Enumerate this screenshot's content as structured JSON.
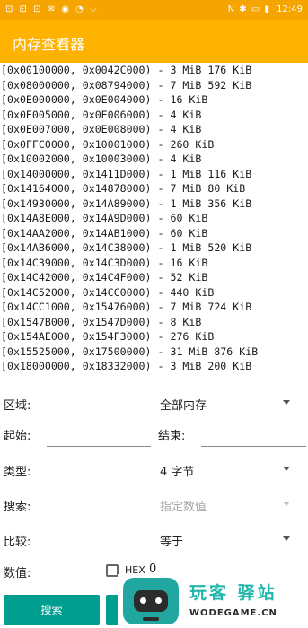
{
  "status_bar": {
    "left_icons": "⊡ ⊡ ⊡ ✉ ◉ ◔ ⌵",
    "right_icons": "N ✱ ▭ ▮",
    "time": "12:49"
  },
  "app_bar": {
    "title": "内存查看器"
  },
  "regions": [
    "[0x00100000, 0x0042C000) - 3 MiB 176 KiB",
    "[0x08000000, 0x08794000) - 7 MiB 592 KiB",
    "[0x0E000000, 0x0E004000) - 16 KiB",
    "[0x0E005000, 0x0E006000) - 4 KiB",
    "[0x0E007000, 0x0E008000) - 4 KiB",
    "[0x0FFC0000, 0x10001000) - 260 KiB",
    "[0x10002000, 0x10003000) - 4 KiB",
    "[0x14000000, 0x1411D000) - 1 MiB 116 KiB",
    "[0x14164000, 0x14878000) - 7 MiB 80 KiB",
    "[0x14930000, 0x14A89000) - 1 MiB 356 KiB",
    "[0x14A8E000, 0x14A9D000) - 60 KiB",
    "[0x14AA2000, 0x14AB1000) - 60 KiB",
    "[0x14AB6000, 0x14C38000) - 1 MiB 520 KiB",
    "[0x14C39000, 0x14C3D000) - 16 KiB",
    "[0x14C42000, 0x14C4F000) - 52 KiB",
    "[0x14C52000, 0x14CC0000) - 440 KiB",
    "[0x14CC1000, 0x15476000) - 7 MiB 724 KiB",
    "[0x1547B000, 0x1547D000) - 8 KiB",
    "[0x154AE000, 0x154F3000) - 276 KiB",
    "[0x15525000, 0x17500000) - 31 MiB 876 KiB",
    "[0x18000000, 0x18332000) - 3 MiB 200 KiB"
  ],
  "form": {
    "region_label": "区域:",
    "region_value": "全部内存",
    "start_label": "起始:",
    "start_value": "",
    "end_label": "结束:",
    "end_value": "",
    "type_label": "类型:",
    "type_value": "4 字节",
    "search_label": "搜索:",
    "search_placeholder": "指定数值",
    "compare_label": "比较:",
    "compare_value": "等于",
    "value_label": "数值:",
    "hex_label": "HEX",
    "hex_checked": false,
    "value": "0"
  },
  "buttons": {
    "search": "搜索"
  },
  "watermark": {
    "text_cn": "玩客 驿站",
    "text_en": "WODEGAME.CN"
  },
  "colors": {
    "status_bar": "#f5a400",
    "app_bar": "#ffb300",
    "button": "#009e8e",
    "watermark_accent": "#1fb5ab"
  },
  "icons": [
    "arrow-drop-down-icon",
    "checkbox-icon",
    "robot-logo-icon"
  ]
}
